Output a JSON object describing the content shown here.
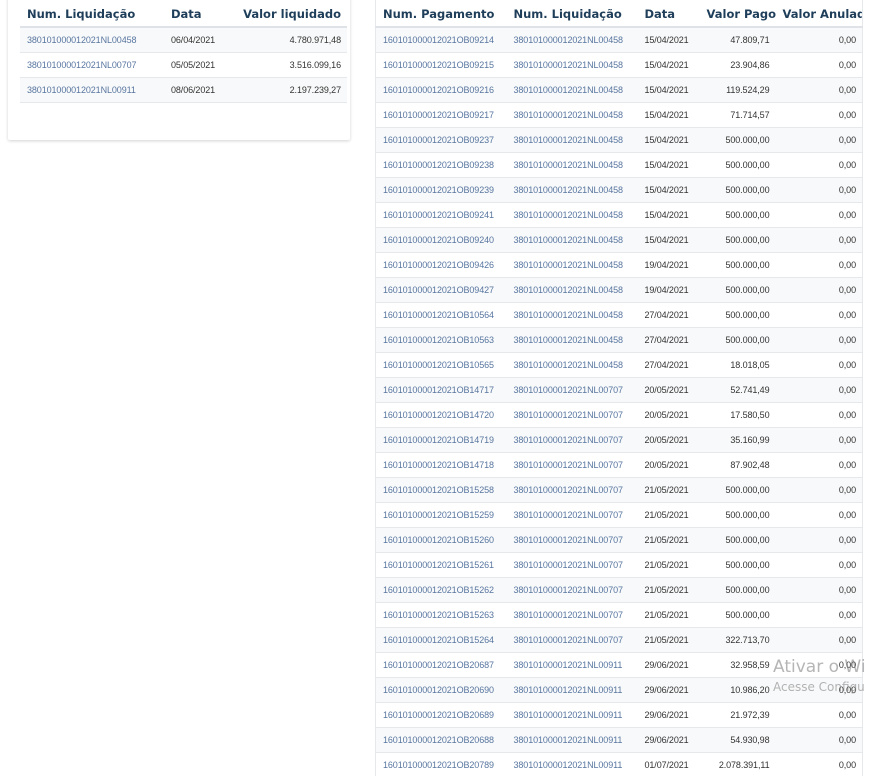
{
  "liquidacoes": {
    "headers": {
      "num": "Num. Liquidação",
      "data": "Data",
      "valor": "Valor liquidado"
    },
    "rows": [
      {
        "num": "380101000012021NL00458",
        "data": "06/04/2021",
        "valor": "4.780.971,48"
      },
      {
        "num": "380101000012021NL00707",
        "data": "05/05/2021",
        "valor": "3.516.099,16"
      },
      {
        "num": "380101000012021NL00911",
        "data": "08/06/2021",
        "valor": "2.197.239,27"
      }
    ]
  },
  "pagamentos": {
    "headers": {
      "num_pagamento": "Num. Pagamento",
      "num_liquidacao": "Num. Liquidação",
      "data": "Data",
      "valor_pago": "Valor Pago",
      "valor_anulado": "Valor Anulado"
    },
    "rows": [
      {
        "pag": "160101000012021OB09214",
        "liq": "380101000012021NL00458",
        "data": "15/04/2021",
        "pago": "47.809,71",
        "anulado": "0,00"
      },
      {
        "pag": "160101000012021OB09215",
        "liq": "380101000012021NL00458",
        "data": "15/04/2021",
        "pago": "23.904,86",
        "anulado": "0,00"
      },
      {
        "pag": "160101000012021OB09216",
        "liq": "380101000012021NL00458",
        "data": "15/04/2021",
        "pago": "119.524,29",
        "anulado": "0,00"
      },
      {
        "pag": "160101000012021OB09217",
        "liq": "380101000012021NL00458",
        "data": "15/04/2021",
        "pago": "71.714,57",
        "anulado": "0,00"
      },
      {
        "pag": "160101000012021OB09237",
        "liq": "380101000012021NL00458",
        "data": "15/04/2021",
        "pago": "500.000,00",
        "anulado": "0,00"
      },
      {
        "pag": "160101000012021OB09238",
        "liq": "380101000012021NL00458",
        "data": "15/04/2021",
        "pago": "500.000,00",
        "anulado": "0,00"
      },
      {
        "pag": "160101000012021OB09239",
        "liq": "380101000012021NL00458",
        "data": "15/04/2021",
        "pago": "500.000,00",
        "anulado": "0,00"
      },
      {
        "pag": "160101000012021OB09241",
        "liq": "380101000012021NL00458",
        "data": "15/04/2021",
        "pago": "500.000,00",
        "anulado": "0,00"
      },
      {
        "pag": "160101000012021OB09240",
        "liq": "380101000012021NL00458",
        "data": "15/04/2021",
        "pago": "500.000,00",
        "anulado": "0,00"
      },
      {
        "pag": "160101000012021OB09426",
        "liq": "380101000012021NL00458",
        "data": "19/04/2021",
        "pago": "500.000,00",
        "anulado": "0,00"
      },
      {
        "pag": "160101000012021OB09427",
        "liq": "380101000012021NL00458",
        "data": "19/04/2021",
        "pago": "500.000,00",
        "anulado": "0,00"
      },
      {
        "pag": "160101000012021OB10564",
        "liq": "380101000012021NL00458",
        "data": "27/04/2021",
        "pago": "500.000,00",
        "anulado": "0,00"
      },
      {
        "pag": "160101000012021OB10563",
        "liq": "380101000012021NL00458",
        "data": "27/04/2021",
        "pago": "500.000,00",
        "anulado": "0,00"
      },
      {
        "pag": "160101000012021OB10565",
        "liq": "380101000012021NL00458",
        "data": "27/04/2021",
        "pago": "18.018,05",
        "anulado": "0,00"
      },
      {
        "pag": "160101000012021OB14717",
        "liq": "380101000012021NL00707",
        "data": "20/05/2021",
        "pago": "52.741,49",
        "anulado": "0,00"
      },
      {
        "pag": "160101000012021OB14720",
        "liq": "380101000012021NL00707",
        "data": "20/05/2021",
        "pago": "17.580,50",
        "anulado": "0,00"
      },
      {
        "pag": "160101000012021OB14719",
        "liq": "380101000012021NL00707",
        "data": "20/05/2021",
        "pago": "35.160,99",
        "anulado": "0,00"
      },
      {
        "pag": "160101000012021OB14718",
        "liq": "380101000012021NL00707",
        "data": "20/05/2021",
        "pago": "87.902,48",
        "anulado": "0,00"
      },
      {
        "pag": "160101000012021OB15258",
        "liq": "380101000012021NL00707",
        "data": "21/05/2021",
        "pago": "500.000,00",
        "anulado": "0,00"
      },
      {
        "pag": "160101000012021OB15259",
        "liq": "380101000012021NL00707",
        "data": "21/05/2021",
        "pago": "500.000,00",
        "anulado": "0,00"
      },
      {
        "pag": "160101000012021OB15260",
        "liq": "380101000012021NL00707",
        "data": "21/05/2021",
        "pago": "500.000,00",
        "anulado": "0,00"
      },
      {
        "pag": "160101000012021OB15261",
        "liq": "380101000012021NL00707",
        "data": "21/05/2021",
        "pago": "500.000,00",
        "anulado": "0,00"
      },
      {
        "pag": "160101000012021OB15262",
        "liq": "380101000012021NL00707",
        "data": "21/05/2021",
        "pago": "500.000,00",
        "anulado": "0,00"
      },
      {
        "pag": "160101000012021OB15263",
        "liq": "380101000012021NL00707",
        "data": "21/05/2021",
        "pago": "500.000,00",
        "anulado": "0,00"
      },
      {
        "pag": "160101000012021OB15264",
        "liq": "380101000012021NL00707",
        "data": "21/05/2021",
        "pago": "322.713,70",
        "anulado": "0,00"
      },
      {
        "pag": "160101000012021OB20687",
        "liq": "380101000012021NL00911",
        "data": "29/06/2021",
        "pago": "32.958,59",
        "anulado": "0,00"
      },
      {
        "pag": "160101000012021OB20690",
        "liq": "380101000012021NL00911",
        "data": "29/06/2021",
        "pago": "10.986,20",
        "anulado": "0,00"
      },
      {
        "pag": "160101000012021OB20689",
        "liq": "380101000012021NL00911",
        "data": "29/06/2021",
        "pago": "21.972,39",
        "anulado": "0,00"
      },
      {
        "pag": "160101000012021OB20688",
        "liq": "380101000012021NL00911",
        "data": "29/06/2021",
        "pago": "54.930,98",
        "anulado": "0,00"
      },
      {
        "pag": "160101000012021OB20789",
        "liq": "380101000012021NL00911",
        "data": "01/07/2021",
        "pago": "2.078.391,11",
        "anulado": "0,00"
      }
    ]
  },
  "watermark": {
    "title": "Ativar o Wi",
    "subtitle": "Acesse Configu"
  }
}
